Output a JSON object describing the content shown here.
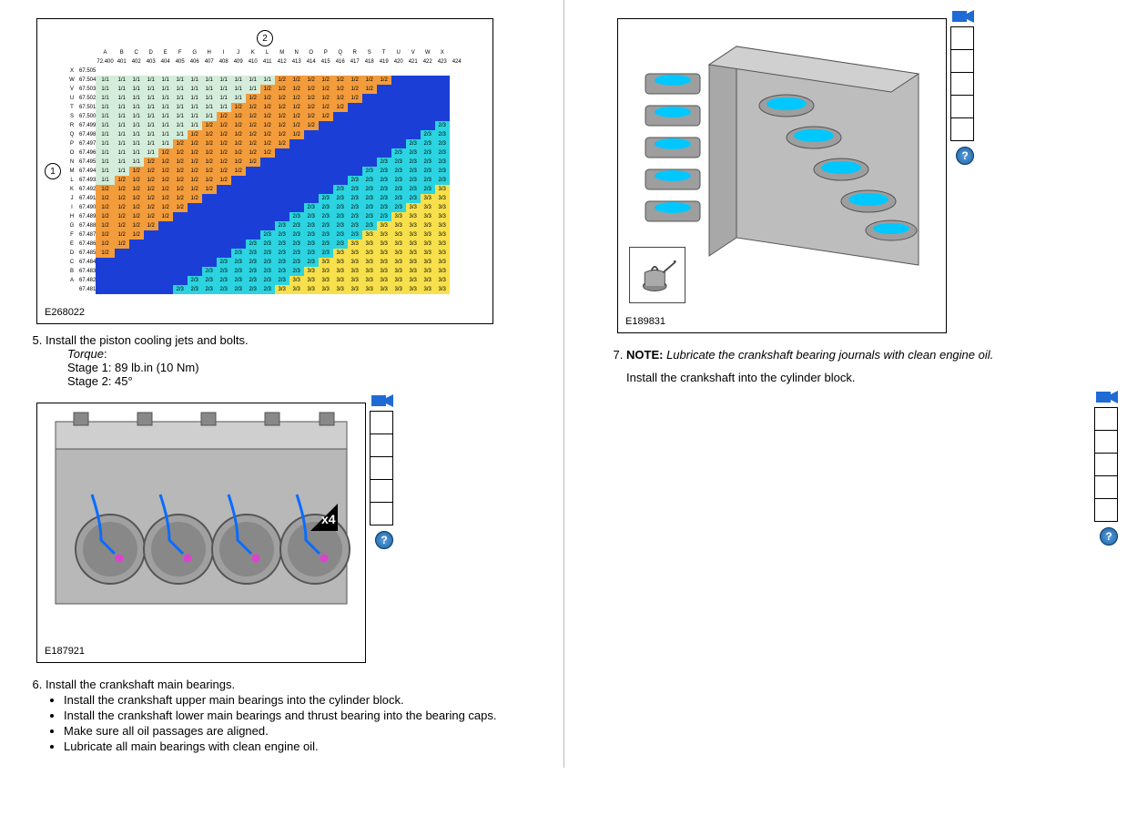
{
  "chart": {
    "fig_id": "E268022",
    "callout_top": "2",
    "callout_left": "1",
    "col_letters": [
      "A",
      "B",
      "C",
      "D",
      "E",
      "F",
      "G",
      "H",
      "I",
      "J",
      "K",
      "L",
      "M",
      "N",
      "O",
      "P",
      "Q",
      "R",
      "S",
      "T",
      "U",
      "V",
      "W",
      "X"
    ],
    "col_nums": [
      "72.400",
      "401",
      "402",
      "403",
      "404",
      "405",
      "406",
      "407",
      "408",
      "409",
      "410",
      "411",
      "412",
      "413",
      "414",
      "415",
      "416",
      "417",
      "418",
      "419",
      "420",
      "421",
      "422",
      "423",
      "424"
    ],
    "rows": [
      {
        "l": "X",
        "v": "67.505",
        "cells": []
      },
      {
        "l": "W",
        "v": "67.504",
        "cells": [
          "g",
          "g",
          "g",
          "g",
          "g",
          "g",
          "g",
          "g",
          "g",
          "g",
          "g",
          "g",
          "o",
          "o",
          "o",
          "o",
          "o",
          "o",
          "o",
          "o",
          "b",
          "b",
          "b",
          "b"
        ]
      },
      {
        "l": "V",
        "v": "67.503",
        "cells": [
          "g",
          "g",
          "g",
          "g",
          "g",
          "g",
          "g",
          "g",
          "g",
          "g",
          "g",
          "o",
          "o",
          "o",
          "o",
          "o",
          "o",
          "o",
          "o",
          "b",
          "b",
          "b",
          "b",
          "b"
        ]
      },
      {
        "l": "U",
        "v": "67.502",
        "cells": [
          "g",
          "g",
          "g",
          "g",
          "g",
          "g",
          "g",
          "g",
          "g",
          "g",
          "o",
          "o",
          "o",
          "o",
          "o",
          "o",
          "o",
          "o",
          "b",
          "b",
          "b",
          "b",
          "b",
          "b"
        ]
      },
      {
        "l": "T",
        "v": "67.501",
        "cells": [
          "g",
          "g",
          "g",
          "g",
          "g",
          "g",
          "g",
          "g",
          "g",
          "o",
          "o",
          "o",
          "o",
          "o",
          "o",
          "o",
          "o",
          "b",
          "b",
          "b",
          "b",
          "b",
          "b",
          "b"
        ]
      },
      {
        "l": "S",
        "v": "67.500",
        "cells": [
          "g",
          "g",
          "g",
          "g",
          "g",
          "g",
          "g",
          "g",
          "o",
          "o",
          "o",
          "o",
          "o",
          "o",
          "o",
          "o",
          "b",
          "b",
          "b",
          "b",
          "b",
          "b",
          "b",
          "b"
        ]
      },
      {
        "l": "R",
        "v": "67.499",
        "cells": [
          "g",
          "g",
          "g",
          "g",
          "g",
          "g",
          "g",
          "o",
          "o",
          "o",
          "o",
          "o",
          "o",
          "o",
          "o",
          "b",
          "b",
          "b",
          "b",
          "b",
          "b",
          "b",
          "b",
          "c"
        ]
      },
      {
        "l": "Q",
        "v": "67.498",
        "cells": [
          "g",
          "g",
          "g",
          "g",
          "g",
          "g",
          "o",
          "o",
          "o",
          "o",
          "o",
          "o",
          "o",
          "o",
          "b",
          "b",
          "b",
          "b",
          "b",
          "b",
          "b",
          "b",
          "c",
          "c"
        ]
      },
      {
        "l": "P",
        "v": "67.497",
        "cells": [
          "g",
          "g",
          "g",
          "g",
          "g",
          "o",
          "o",
          "o",
          "o",
          "o",
          "o",
          "o",
          "o",
          "b",
          "b",
          "b",
          "b",
          "b",
          "b",
          "b",
          "b",
          "c",
          "c",
          "c"
        ]
      },
      {
        "l": "O",
        "v": "67.496",
        "cells": [
          "g",
          "g",
          "g",
          "g",
          "o",
          "o",
          "o",
          "o",
          "o",
          "o",
          "o",
          "o",
          "b",
          "b",
          "b",
          "b",
          "b",
          "b",
          "b",
          "b",
          "c",
          "c",
          "c",
          "c"
        ]
      },
      {
        "l": "N",
        "v": "67.495",
        "cells": [
          "g",
          "g",
          "g",
          "o",
          "o",
          "o",
          "o",
          "o",
          "o",
          "o",
          "o",
          "b",
          "b",
          "b",
          "b",
          "b",
          "b",
          "b",
          "b",
          "c",
          "c",
          "c",
          "c",
          "c"
        ]
      },
      {
        "l": "M",
        "v": "67.494",
        "cells": [
          "g",
          "g",
          "o",
          "o",
          "o",
          "o",
          "o",
          "o",
          "o",
          "o",
          "b",
          "b",
          "b",
          "b",
          "b",
          "b",
          "b",
          "b",
          "c",
          "c",
          "c",
          "c",
          "c",
          "c"
        ]
      },
      {
        "l": "L",
        "v": "67.493",
        "cells": [
          "g",
          "o",
          "o",
          "o",
          "o",
          "o",
          "o",
          "o",
          "o",
          "b",
          "b",
          "b",
          "b",
          "b",
          "b",
          "b",
          "b",
          "c",
          "c",
          "c",
          "c",
          "c",
          "c",
          "c"
        ]
      },
      {
        "l": "K",
        "v": "67.492",
        "cells": [
          "o",
          "o",
          "o",
          "o",
          "o",
          "o",
          "o",
          "o",
          "b",
          "b",
          "b",
          "b",
          "b",
          "b",
          "b",
          "b",
          "c",
          "c",
          "c",
          "c",
          "c",
          "c",
          "c",
          "y"
        ]
      },
      {
        "l": "J",
        "v": "67.491",
        "cells": [
          "o",
          "o",
          "o",
          "o",
          "o",
          "o",
          "o",
          "b",
          "b",
          "b",
          "b",
          "b",
          "b",
          "b",
          "b",
          "c",
          "c",
          "c",
          "c",
          "c",
          "c",
          "c",
          "y",
          "y"
        ]
      },
      {
        "l": "I",
        "v": "67.490",
        "cells": [
          "o",
          "o",
          "o",
          "o",
          "o",
          "o",
          "b",
          "b",
          "b",
          "b",
          "b",
          "b",
          "b",
          "b",
          "c",
          "c",
          "c",
          "c",
          "c",
          "c",
          "c",
          "y",
          "y",
          "y"
        ]
      },
      {
        "l": "H",
        "v": "67.489",
        "cells": [
          "o",
          "o",
          "o",
          "o",
          "o",
          "b",
          "b",
          "b",
          "b",
          "b",
          "b",
          "b",
          "b",
          "c",
          "c",
          "c",
          "c",
          "c",
          "c",
          "c",
          "y",
          "y",
          "y",
          "y"
        ]
      },
      {
        "l": "G",
        "v": "67.488",
        "cells": [
          "o",
          "o",
          "o",
          "o",
          "b",
          "b",
          "b",
          "b",
          "b",
          "b",
          "b",
          "b",
          "c",
          "c",
          "c",
          "c",
          "c",
          "c",
          "c",
          "y",
          "y",
          "y",
          "y",
          "y"
        ]
      },
      {
        "l": "F",
        "v": "67.487",
        "cells": [
          "o",
          "o",
          "o",
          "b",
          "b",
          "b",
          "b",
          "b",
          "b",
          "b",
          "b",
          "c",
          "c",
          "c",
          "c",
          "c",
          "c",
          "c",
          "y",
          "y",
          "y",
          "y",
          "y",
          "y"
        ]
      },
      {
        "l": "E",
        "v": "67.486",
        "cells": [
          "o",
          "o",
          "b",
          "b",
          "b",
          "b",
          "b",
          "b",
          "b",
          "b",
          "c",
          "c",
          "c",
          "c",
          "c",
          "c",
          "c",
          "y",
          "y",
          "y",
          "y",
          "y",
          "y",
          "y"
        ]
      },
      {
        "l": "D",
        "v": "67.485",
        "cells": [
          "o",
          "b",
          "b",
          "b",
          "b",
          "b",
          "b",
          "b",
          "b",
          "c",
          "c",
          "c",
          "c",
          "c",
          "c",
          "c",
          "y",
          "y",
          "y",
          "y",
          "y",
          "y",
          "y",
          "y"
        ]
      },
      {
        "l": "C",
        "v": "67.484",
        "cells": [
          "b",
          "b",
          "b",
          "b",
          "b",
          "b",
          "b",
          "b",
          "c",
          "c",
          "c",
          "c",
          "c",
          "c",
          "c",
          "y",
          "y",
          "y",
          "y",
          "y",
          "y",
          "y",
          "y",
          "y"
        ]
      },
      {
        "l": "B",
        "v": "67.483",
        "cells": [
          "b",
          "b",
          "b",
          "b",
          "b",
          "b",
          "b",
          "c",
          "c",
          "c",
          "c",
          "c",
          "c",
          "c",
          "y",
          "y",
          "y",
          "y",
          "y",
          "y",
          "y",
          "y",
          "y",
          "y"
        ]
      },
      {
        "l": "A",
        "v": "67.482",
        "cells": [
          "b",
          "b",
          "b",
          "b",
          "b",
          "b",
          "c",
          "c",
          "c",
          "c",
          "c",
          "c",
          "c",
          "y",
          "y",
          "y",
          "y",
          "y",
          "y",
          "y",
          "y",
          "y",
          "y",
          "y"
        ]
      },
      {
        "l": "",
        "v": "67.481",
        "cells": [
          "b",
          "b",
          "b",
          "b",
          "b",
          "c",
          "c",
          "c",
          "c",
          "c",
          "c",
          "c",
          "y",
          "y",
          "y",
          "y",
          "y",
          "y",
          "y",
          "y",
          "y",
          "y",
          "y",
          "y"
        ]
      }
    ],
    "cell_text": {
      "g": "1/1",
      "o": "1/2",
      "b": "—",
      "c": "2/3",
      "y": "3/3"
    }
  },
  "step5": {
    "num": "5.",
    "title": "Install the piston cooling jets and bolts.",
    "torque_label": "Torque",
    "stage1": "Stage 1:  89 lb.in (10 Nm)",
    "stage2": "Stage 2:  45°",
    "fig_id": "E187921",
    "x4": "x4"
  },
  "step6": {
    "num": "6.",
    "title": "Install the crankshaft main bearings.",
    "b1": "Install the crankshaft upper main bearings into the cylinder block.",
    "b2": "Install the crankshaft lower main bearings and thrust bearing into the bearing caps.",
    "b3": "Make sure all oil passages are aligned.",
    "b4": "Lubricate all main bearings with clean engine oil."
  },
  "step7": {
    "num": "7.",
    "note_label": "NOTE:",
    "note_body": "Lubricate the crankshaft bearing journals with clean engine oil.",
    "title": "Install the crankshaft into the cylinder block.",
    "fig_id": "E189831"
  }
}
